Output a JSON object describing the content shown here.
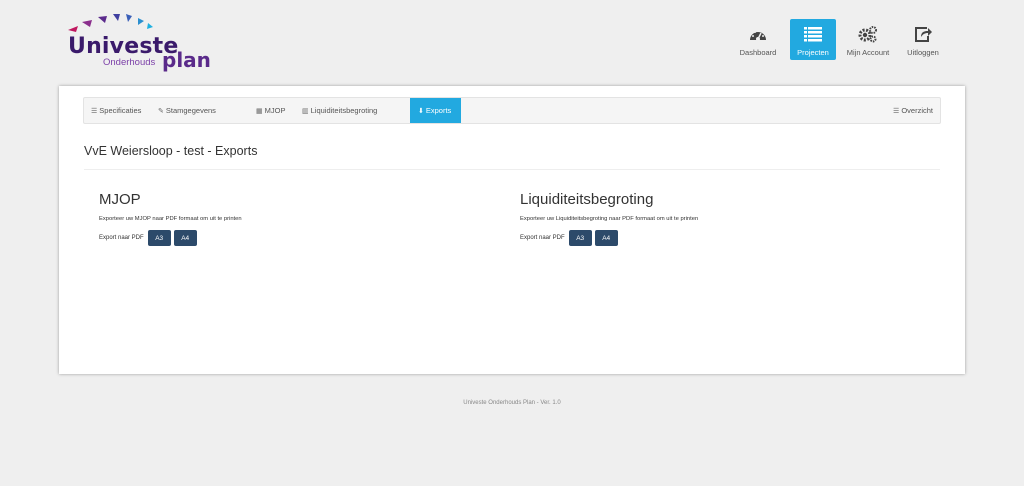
{
  "brand": {
    "name_main": "Univeste",
    "name_sub": "Onderhouds",
    "name_tail": "plan",
    "colors": {
      "purple": "#3a1a6b",
      "accent": "#22a9e0",
      "button": "#2c4a6a"
    }
  },
  "nav": [
    {
      "label": "Dashboard",
      "icon": "dashboard-icon",
      "active": false
    },
    {
      "label": "Projecten",
      "icon": "list-icon",
      "active": true
    },
    {
      "label": "Mijn Account",
      "icon": "gears-icon",
      "active": false
    },
    {
      "label": "Uitloggen",
      "icon": "share-icon",
      "active": false
    }
  ],
  "subnav": {
    "specificaties": "Specificaties",
    "stamgegevens": "Stamgegevens",
    "mjop": "MJOP",
    "liquiditeitsbegroting": "Liquiditeitsbegroting",
    "exports": "Exports",
    "overzicht": "Overzicht"
  },
  "page_title": "VvE Weiersloop - test - Exports",
  "sections": [
    {
      "title": "MJOP",
      "description": "Exporteer uw MJOP naar PDF formaat om uit te printen",
      "export_label": "Export naar PDF",
      "buttons": [
        "A3",
        "A4"
      ]
    },
    {
      "title": "Liquiditeitsbegroting",
      "description": "Exporteer uw Liquiditeitsbegroting naar PDF formaat om uit te printen",
      "export_label": "Export naar PDF",
      "buttons": [
        "A3",
        "A4"
      ]
    }
  ],
  "footer": "Univeste Onderhouds Plan - Ver. 1.0"
}
